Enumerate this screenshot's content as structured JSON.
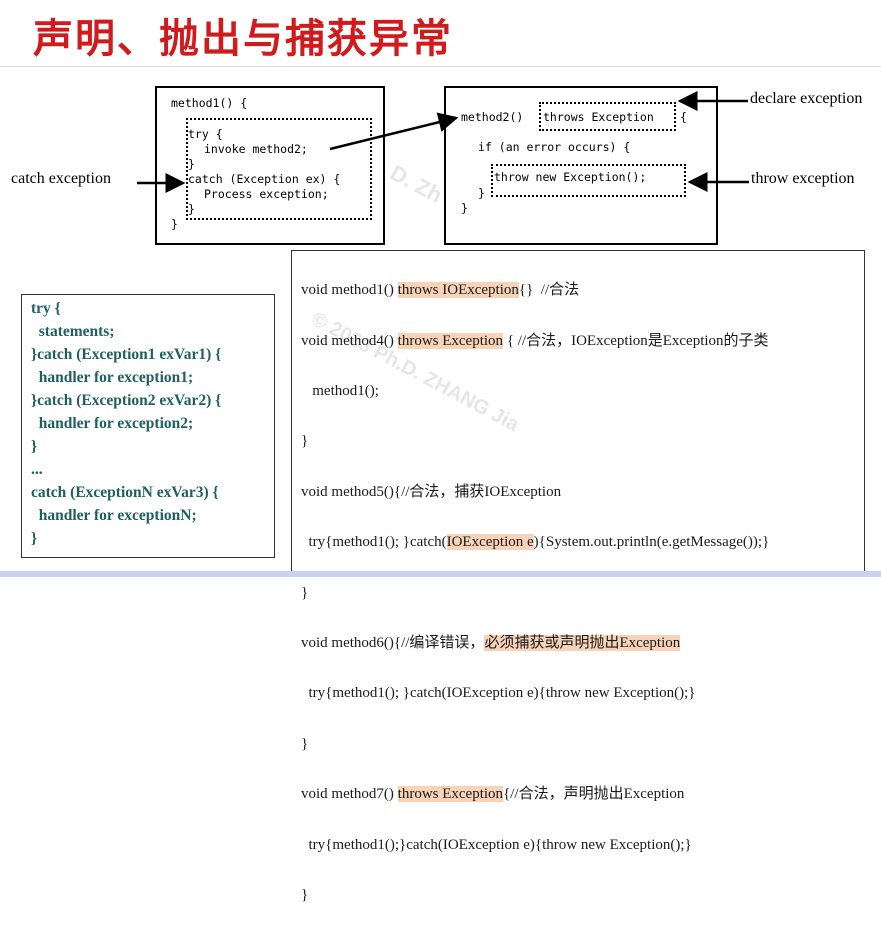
{
  "title": "声明、抛出与捕获异常",
  "watermark": {
    "text_top": "D. Zh",
    "text_bottom": "© 2023 Ph.D. ZHANG Jia"
  },
  "labels": {
    "catch": "catch exception",
    "declare": "declare exception",
    "throw": "throw exception"
  },
  "method1_box": {
    "header": "method1() {",
    "try_open": "try {",
    "invoke": "invoke method2;",
    "try_close": "}",
    "catch_line": "catch (Exception ex) {",
    "process": "Process exception;",
    "catch_close": "}",
    "close": "}"
  },
  "method2_box": {
    "prefix": "method2()",
    "throws": "throws Exception",
    "brace": "{",
    "if_line": "if (an error occurs) {",
    "throw_stmt": "throw new Exception();",
    "inner_close": "}",
    "close": "}"
  },
  "try_catch_syntax": [
    "try {",
    "  statements;",
    "}catch (Exception1 exVar1) {",
    "  handler for exception1;",
    "}catch (Exception2 exVar2) {",
    "  handler for exception2;",
    "}",
    "...",
    "catch (ExceptionN exVar3) {",
    "  handler for exceptionN;",
    "}"
  ],
  "code_examples": {
    "l1_a": "void method1() ",
    "l1_hl": "throws IOException",
    "l1_b": "{}  //合法",
    "l2_a": "void method4() ",
    "l2_hl": "throws Exception",
    "l2_b": " { //合法，IOException是Exception的子类",
    "l3": "   method1();",
    "l4": "}",
    "l5": "void method5(){//合法，捕获IOException",
    "l6_a": "  try{method1(); }catch(",
    "l6_hl": "IOException e",
    "l6_b": "){System.out.println(e.getMessage());}",
    "l7": "}",
    "l8_a": "void method6(){//编译错误，",
    "l8_hl": "必须捕获或声明抛出Exception",
    "l9": "  try{method1(); }catch(IOException e){throw new Exception();}",
    "l10": "}",
    "l11_a": "void method7() ",
    "l11_hl": "throws Exception",
    "l11_b": "{//合法，声明抛出Exception",
    "l12": "  try{method1();}catch(IOException e){throw new Exception();}",
    "l13": "}"
  }
}
